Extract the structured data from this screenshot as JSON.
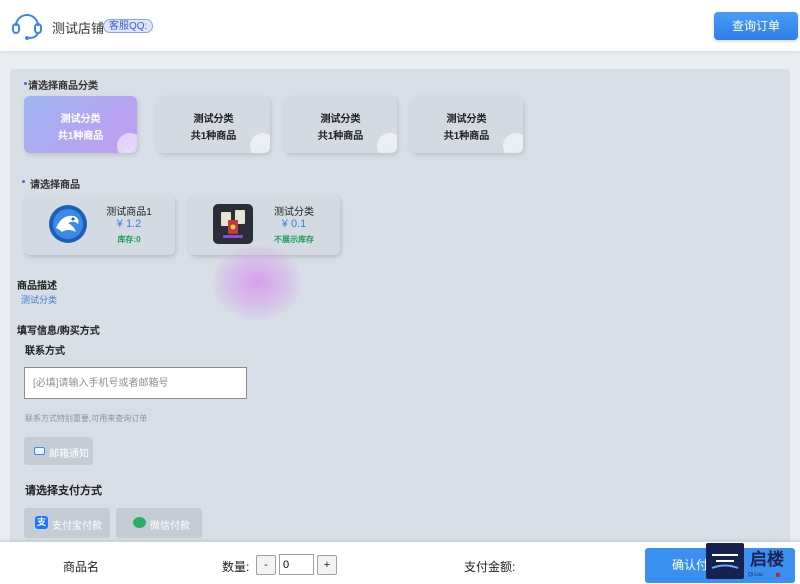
{
  "header": {
    "shop_name": "测试店铺",
    "qq_badge": "客服QQ:",
    "query_button": "查询订单"
  },
  "categories": {
    "title": "请选择商品分类",
    "items": [
      {
        "name": "测试分类",
        "count": "共1种商品",
        "selected": true
      },
      {
        "name": "测试分类",
        "count": "共1种商品",
        "selected": false
      },
      {
        "name": "测试分类",
        "count": "共1种商品",
        "selected": false
      },
      {
        "name": "测试分类",
        "count": "共1种商品",
        "selected": false
      }
    ]
  },
  "products": {
    "title": "请选择商品",
    "items": [
      {
        "name": "测试商品1",
        "price": "¥ 1.2",
        "stock": "库存:0"
      },
      {
        "name": "测试分类",
        "price": "¥ 0.1",
        "stock": "不展示库存"
      }
    ]
  },
  "description": {
    "label": "商品描述",
    "value": "测试分类"
  },
  "form": {
    "section_label": "填写信息/购买方式",
    "contact_label": "联系方式",
    "contact_placeholder": "[必填]请输入手机号或者邮箱号",
    "contact_hint": "联系方式特别重要,可用来查询订单",
    "email_notify": "邮箱通知",
    "payment_label": "请选择支付方式",
    "alipay": "支付宝付款",
    "wechat": "微信付款"
  },
  "bottom": {
    "product_name_label": "商品名",
    "quantity_label": "数量:",
    "minus": "-",
    "quantity_value": "0",
    "plus": "+",
    "total_label": "支付金额:",
    "confirm": "确认付款"
  },
  "watermark": {
    "text": "启楼",
    "sub": "Qi Lou"
  },
  "colors": {
    "accent": "#3b8ff0",
    "price": "#3a7fe0",
    "stock": "#1f9d55"
  }
}
